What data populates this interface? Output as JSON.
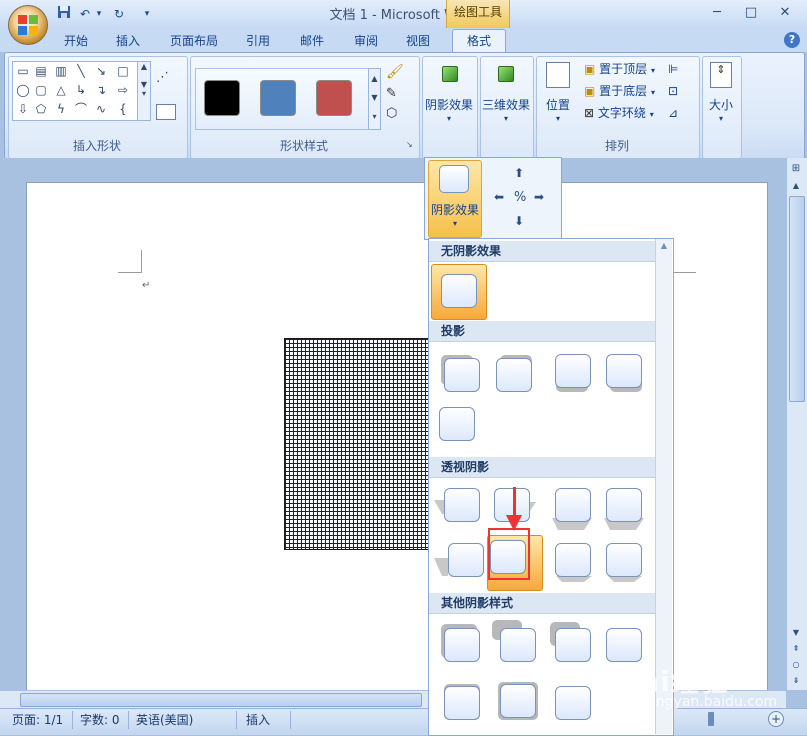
{
  "window": {
    "title": "文档 1 - Microsoft Word",
    "context_tab_group": "绘图工具",
    "controls": {
      "minimize": "─",
      "maximize": "□",
      "close": "✕"
    }
  },
  "quick_access": {
    "save_icon": "save-icon",
    "undo": "↶",
    "redo": "↻",
    "more": "▾"
  },
  "tabs": [
    {
      "label": "开始"
    },
    {
      "label": "插入"
    },
    {
      "label": "页面布局"
    },
    {
      "label": "引用"
    },
    {
      "label": "邮件"
    },
    {
      "label": "审阅"
    },
    {
      "label": "视图"
    },
    {
      "label": "格式",
      "active": true
    }
  ],
  "help": "?",
  "ribbon": {
    "insert_shapes": {
      "label": "插入形状"
    },
    "shape_styles": {
      "label": "形状样式",
      "swatches": [
        "#000000",
        "#4f81bd",
        "#c0504d"
      ]
    },
    "shadow_effects": {
      "label": "阴影效果"
    },
    "threed_effects": {
      "label": "三维效果"
    },
    "arrange": {
      "label": "排列",
      "position": "位置",
      "bring_front": "置于顶层",
      "send_back": "置于底层",
      "text_wrap": "文字环绕"
    },
    "size": {
      "label": "大小"
    }
  },
  "shadow_panel": {
    "button_label": "阴影效果",
    "sections": [
      {
        "title": "无阴影效果"
      },
      {
        "title": "投影"
      },
      {
        "title": "透视阴影"
      },
      {
        "title": "其他阴影样式"
      }
    ]
  },
  "status": {
    "page": "页面: 1/1",
    "words": "字数: 0",
    "language": "英语(美国)",
    "mode": "插入"
  },
  "watermark": {
    "main": "Bai经验",
    "sub": "jingyan.baidu.com"
  },
  "colors": {
    "accent": "#15428b",
    "highlight": "#f6c04a",
    "annotation": "#ee3333"
  }
}
